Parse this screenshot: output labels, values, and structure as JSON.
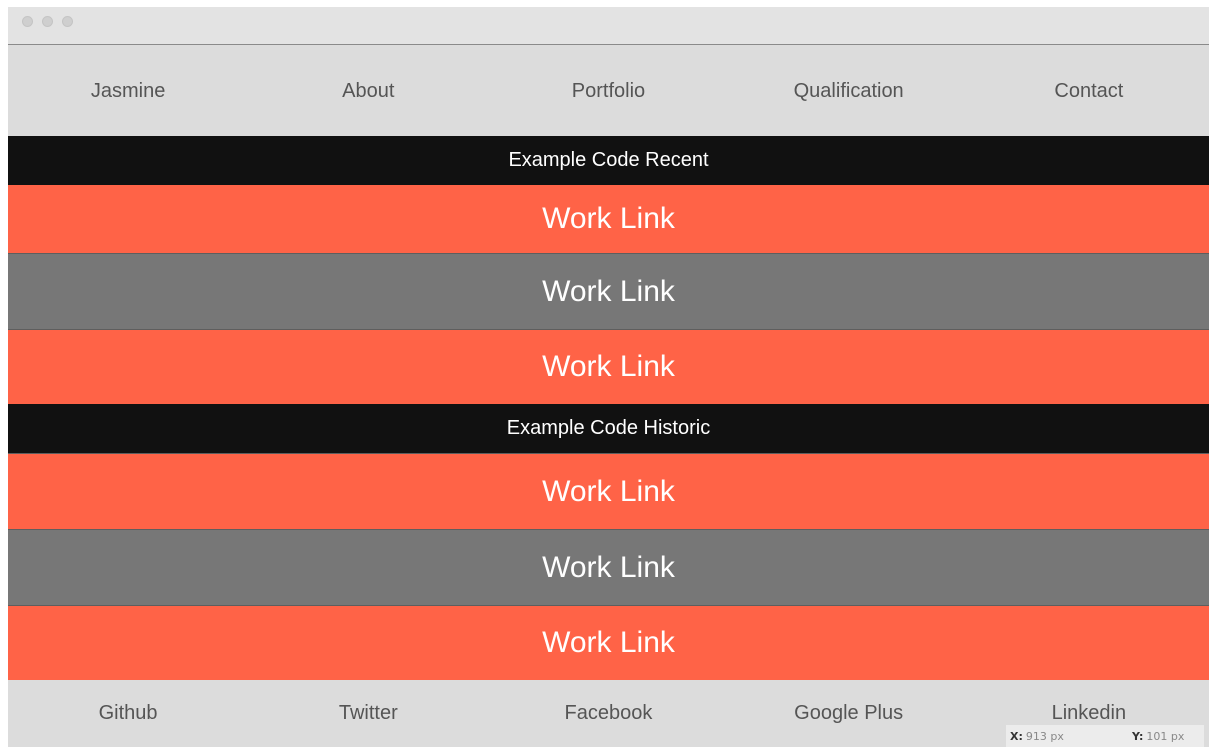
{
  "nav": {
    "items": [
      "Jasmine",
      "About",
      "Portfolio",
      "Qualification",
      "Contact"
    ]
  },
  "sections": {
    "recent_title": "Example Code Recent",
    "historic_title": "Example Code Historic"
  },
  "work_links": {
    "recent": [
      "Work Link",
      "Work Link",
      "Work Link"
    ],
    "historic": [
      "Work Link",
      "Work Link",
      "Work Link"
    ]
  },
  "footer": {
    "items": [
      "Github",
      "Twitter",
      "Facebook",
      "Google Plus",
      "Linkedin"
    ]
  },
  "coords": {
    "x_label": "X:",
    "x_value": "913 px",
    "y_label": "Y:",
    "y_value": "101 px"
  },
  "colors": {
    "accent": "#ff6347",
    "alt": "#777777",
    "header_bg": "#111111",
    "nav_bg": "#dcdcdc"
  }
}
